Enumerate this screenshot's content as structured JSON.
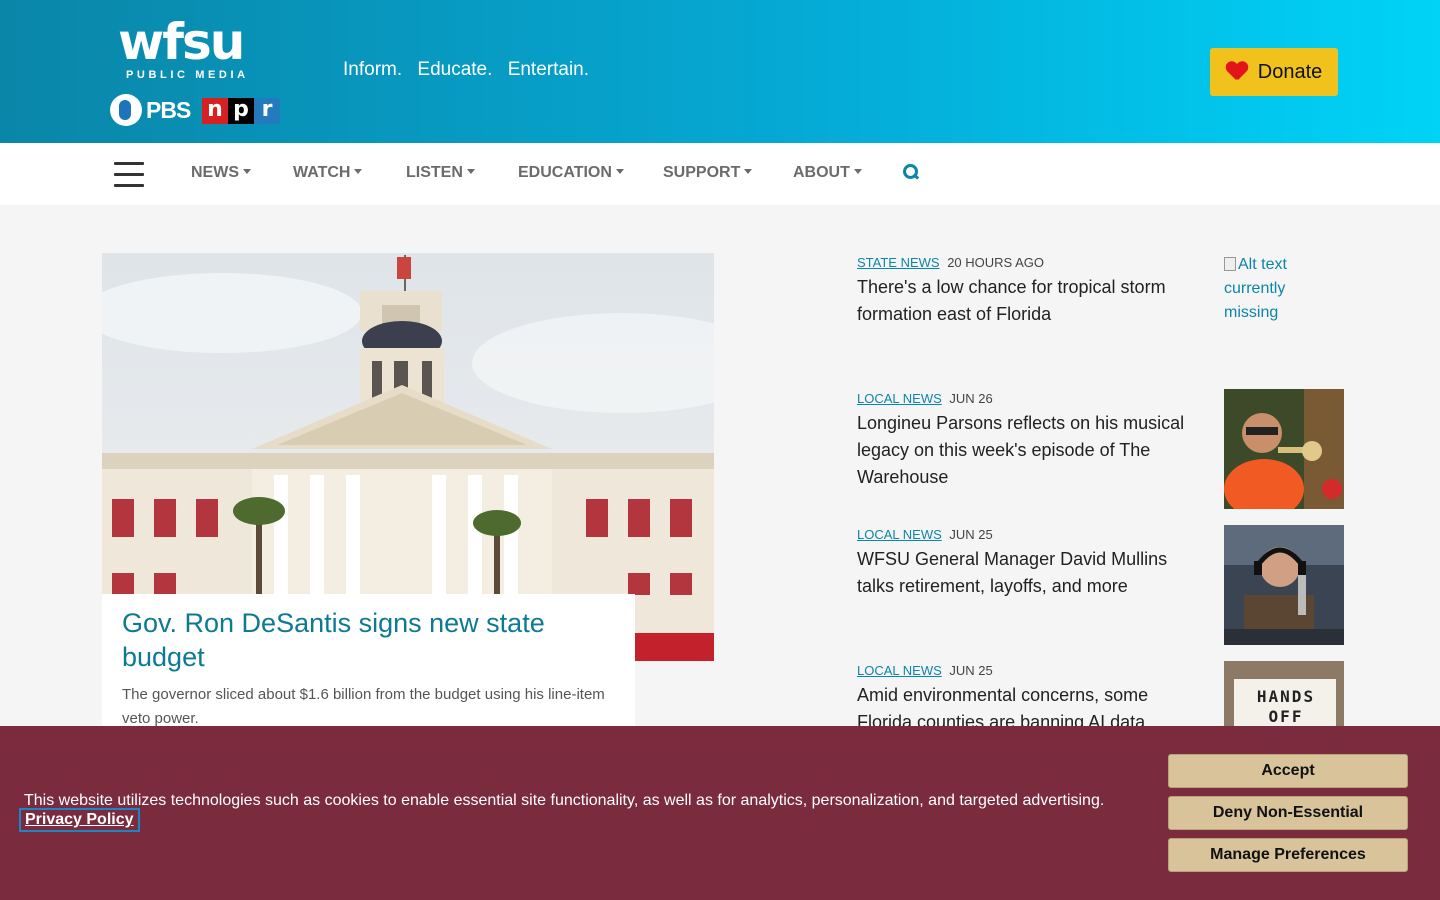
{
  "header": {
    "logo_text": "wfsu",
    "logo_subtext": "PUBLIC MEDIA",
    "pbs_label": "PBS",
    "npr_letters": [
      "n",
      "p",
      "r"
    ],
    "tagline": [
      "Inform.",
      "Educate.",
      "Entertain."
    ],
    "donate_label": "Donate"
  },
  "nav": {
    "items": [
      "NEWS",
      "WATCH",
      "LISTEN",
      "EDUCATION",
      "SUPPORT",
      "ABOUT"
    ]
  },
  "hero": {
    "title": "Gov. Ron DeSantis signs new state budget",
    "description": "The governor sliced about $1.6 billion from the budget using his line-item veto power."
  },
  "stories": [
    {
      "category": "STATE NEWS",
      "time": "20 HOURS AGO",
      "headline": "There's a low chance for tropical storm formation east of Florida",
      "image_alt": "Alt text currently missing"
    },
    {
      "category": "LOCAL NEWS",
      "time": "JUN 26",
      "headline": "Longineu Parsons reflects on his musical legacy on this week's episode of The Warehouse"
    },
    {
      "category": "LOCAL NEWS",
      "time": "JUN 25",
      "headline": "WFSU General Manager David Mullins talks retirement, layoffs, and more"
    },
    {
      "category": "LOCAL NEWS",
      "time": "JUN 25",
      "headline": "Amid environmental concerns, some Florida counties are banning AI data",
      "image_sign_text": "HANDS OFF"
    }
  ],
  "cookie_banner": {
    "message": "This website utilizes technologies such as cookies to enable essential site functionality, as well as for analytics, personalization, and targeted advertising.",
    "privacy_link": "Privacy Policy",
    "accept_label": "Accept",
    "deny_label": "Deny Non-Essential",
    "manage_label": "Manage Preferences"
  },
  "colors": {
    "header_start": "#0a86a8",
    "header_end": "#00d3f7",
    "donate_bg": "#f0c21b",
    "link": "#0c86a8",
    "cookie_bg": "#7a2c3e",
    "cookie_button": "#d8c39a"
  },
  "icons": {
    "menu": "hamburger-icon",
    "search": "search-icon",
    "donate": "heart-icon"
  }
}
